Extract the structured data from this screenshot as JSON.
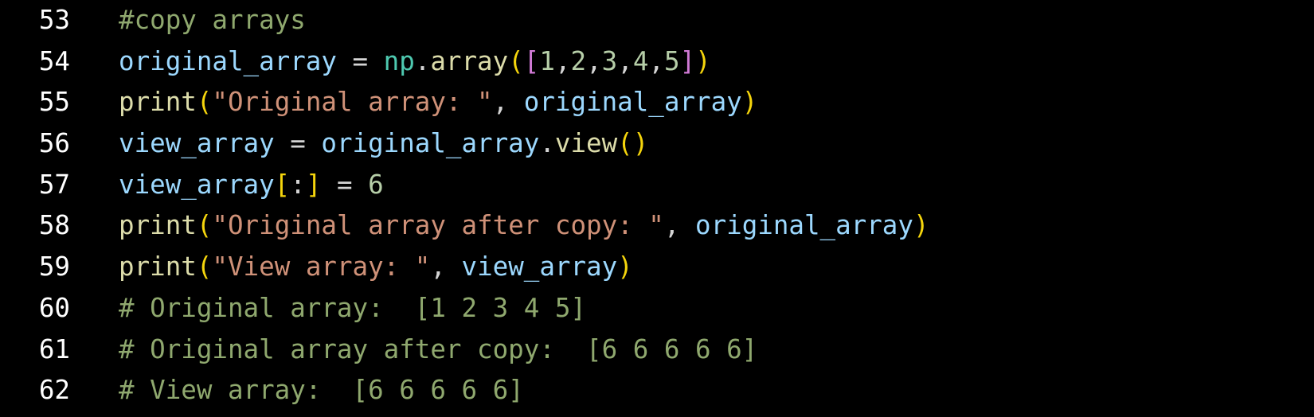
{
  "colors": {
    "background": "#000000",
    "line_number": "#ffffff",
    "comment": "#8fa86e",
    "variable": "#9cd8fe",
    "function": "#dcdcaa",
    "string": "#cf9178",
    "number": "#b6cea8",
    "bracket_gold": "#f5d50c",
    "bracket_purple": "#d17ad6",
    "operator": "#d4d4d4",
    "module": "#4ec9b0"
  },
  "editor": {
    "lines": [
      {
        "number": "53",
        "tokens": [
          {
            "text": "#copy arrays",
            "kind": "comment"
          }
        ]
      },
      {
        "number": "54",
        "tokens": [
          {
            "text": "original_array",
            "kind": "variable"
          },
          {
            "text": " = ",
            "kind": "operator"
          },
          {
            "text": "np",
            "kind": "module"
          },
          {
            "text": ".",
            "kind": "operator"
          },
          {
            "text": "array",
            "kind": "function"
          },
          {
            "text": "(",
            "kind": "bracket_gold"
          },
          {
            "text": "[",
            "kind": "bracket_purple"
          },
          {
            "text": "1",
            "kind": "number"
          },
          {
            "text": ",",
            "kind": "operator"
          },
          {
            "text": "2",
            "kind": "number"
          },
          {
            "text": ",",
            "kind": "operator"
          },
          {
            "text": "3",
            "kind": "number"
          },
          {
            "text": ",",
            "kind": "operator"
          },
          {
            "text": "4",
            "kind": "number"
          },
          {
            "text": ",",
            "kind": "operator"
          },
          {
            "text": "5",
            "kind": "number"
          },
          {
            "text": "]",
            "kind": "bracket_purple"
          },
          {
            "text": ")",
            "kind": "bracket_gold"
          }
        ]
      },
      {
        "number": "55",
        "tokens": [
          {
            "text": "print",
            "kind": "function"
          },
          {
            "text": "(",
            "kind": "bracket_gold"
          },
          {
            "text": "\"Original array: \"",
            "kind": "string"
          },
          {
            "text": ", ",
            "kind": "operator"
          },
          {
            "text": "original_array",
            "kind": "variable"
          },
          {
            "text": ")",
            "kind": "bracket_gold"
          }
        ]
      },
      {
        "number": "56",
        "tokens": [
          {
            "text": "view_array",
            "kind": "variable"
          },
          {
            "text": " = ",
            "kind": "operator"
          },
          {
            "text": "original_array",
            "kind": "variable"
          },
          {
            "text": ".",
            "kind": "operator"
          },
          {
            "text": "view",
            "kind": "function"
          },
          {
            "text": "()",
            "kind": "bracket_gold"
          }
        ]
      },
      {
        "number": "57",
        "tokens": [
          {
            "text": "view_array",
            "kind": "variable"
          },
          {
            "text": "[",
            "kind": "bracket_gold"
          },
          {
            "text": ":",
            "kind": "operator"
          },
          {
            "text": "]",
            "kind": "bracket_gold"
          },
          {
            "text": " = ",
            "kind": "operator"
          },
          {
            "text": "6",
            "kind": "number"
          }
        ]
      },
      {
        "number": "58",
        "tokens": [
          {
            "text": "print",
            "kind": "function"
          },
          {
            "text": "(",
            "kind": "bracket_gold"
          },
          {
            "text": "\"Original array after copy: \"",
            "kind": "string"
          },
          {
            "text": ", ",
            "kind": "operator"
          },
          {
            "text": "original_array",
            "kind": "variable"
          },
          {
            "text": ")",
            "kind": "bracket_gold"
          }
        ]
      },
      {
        "number": "59",
        "tokens": [
          {
            "text": "print",
            "kind": "function"
          },
          {
            "text": "(",
            "kind": "bracket_gold"
          },
          {
            "text": "\"View array: \"",
            "kind": "string"
          },
          {
            "text": ", ",
            "kind": "operator"
          },
          {
            "text": "view_array",
            "kind": "variable"
          },
          {
            "text": ")",
            "kind": "bracket_gold"
          }
        ]
      },
      {
        "number": "60",
        "tokens": [
          {
            "text": "# Original array:  [1 2 3 4 5]",
            "kind": "comment"
          }
        ]
      },
      {
        "number": "61",
        "tokens": [
          {
            "text": "# Original array after copy:  [6 6 6 6 6]",
            "kind": "comment"
          }
        ]
      },
      {
        "number": "62",
        "tokens": [
          {
            "text": "# View array:  [6 6 6 6 6]",
            "kind": "comment"
          }
        ]
      }
    ]
  }
}
